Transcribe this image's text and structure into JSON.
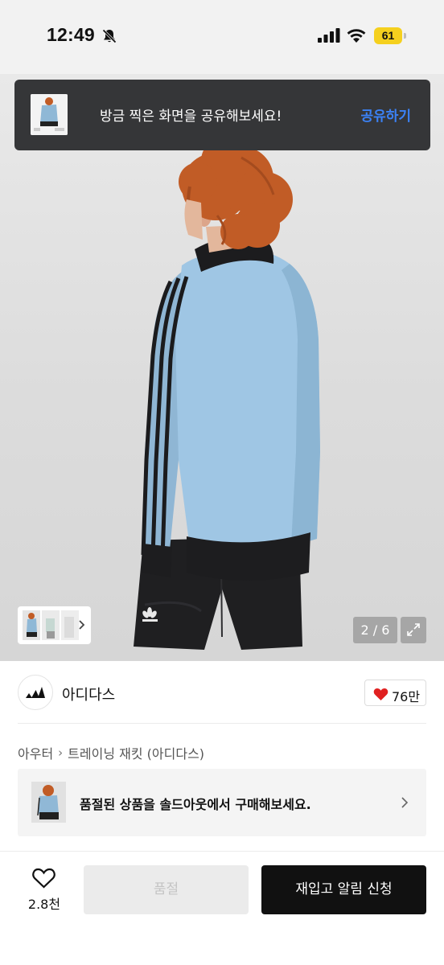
{
  "status_bar": {
    "time": "12:49",
    "battery_level": "61",
    "icons": [
      "bell-slash-icon",
      "signal-icon",
      "wifi-icon",
      "battery-icon"
    ]
  },
  "share_toast": {
    "message": "방금 찍은 화면을 공유해보세요!",
    "action_label": "공유하기",
    "action_color": "#3b82f6"
  },
  "gallery": {
    "counter": "2 / 6",
    "expand_icon": "expand-icon"
  },
  "brand": {
    "name": "아디다스",
    "logo_icon": "adidas-logo-icon"
  },
  "likes": {
    "count": "76만",
    "heart_color": "#e02020"
  },
  "breadcrumb": {
    "category": "아우터",
    "subcategory": "트레이닝 재킷 (아디다스)"
  },
  "soldout_banner": {
    "text": "품절된 상품을 솔드아웃에서 구매해보세요."
  },
  "bottom_bar": {
    "wish_count": "2.8천",
    "soldout_label": "품절",
    "restock_label": "재입고 알림 신청"
  }
}
